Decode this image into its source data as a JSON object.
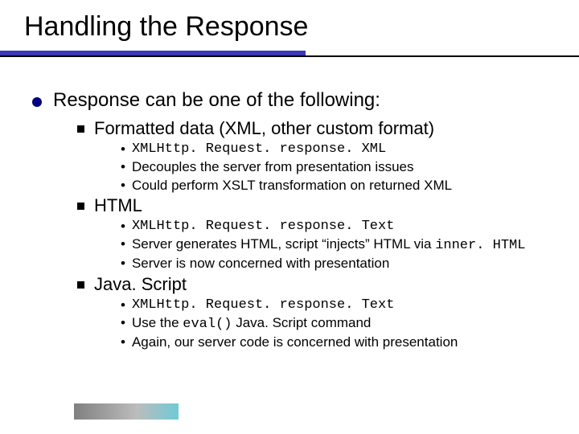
{
  "title": "Handling the Response",
  "lvl1": {
    "text": "Response can be one of the following:"
  },
  "sec1": {
    "heading": "Formatted data (XML, other custom format)",
    "b1_code": "XMLHttp. Request. response. XML",
    "b2": "Decouples the server from presentation issues",
    "b3": "Could perform XSLT transformation on returned XML"
  },
  "sec2": {
    "heading": "HTML",
    "b1_code": "XMLHttp. Request. response. Text",
    "b2_a": "Server generates HTML, script “injects” HTML via ",
    "b2_code": "inner. HTML",
    "b3": "Server is now concerned with presentation"
  },
  "sec3": {
    "heading": "Java. Script",
    "b1_code": "XMLHttp. Request. response. Text",
    "b2_a": "Use the ",
    "b2_code": "eval()",
    "b2_b": " Java. Script command",
    "b3": "Again, our server code is concerned with presentation"
  }
}
